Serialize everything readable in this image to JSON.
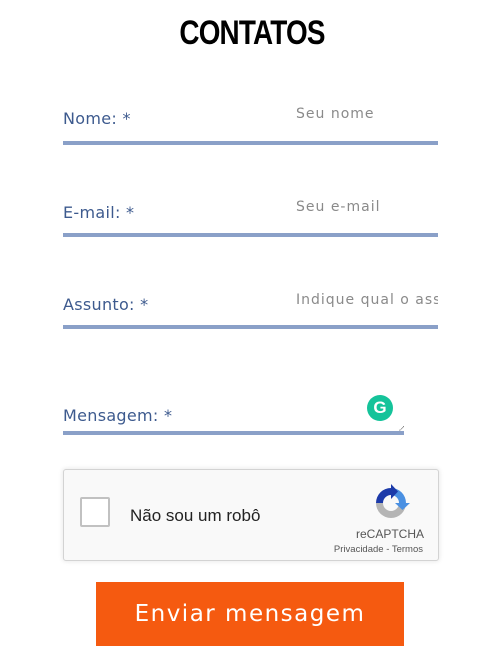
{
  "page": {
    "title": "CONTATOS"
  },
  "form": {
    "name": {
      "label": "Nome: *",
      "placeholder": "Seu nome"
    },
    "email": {
      "label": "E-mail: *",
      "placeholder": "Seu e-mail"
    },
    "subject": {
      "label": "Assunto: *",
      "placeholder": "Indique qual o assunto"
    },
    "message": {
      "label": "Mensagem: *"
    },
    "submit_label": "Enviar mensagem"
  },
  "grammarly": {
    "letter": "G"
  },
  "recaptcha": {
    "checkbox_label": "Não sou um robô",
    "brand": "reCAPTCHA",
    "privacy": "Privacidade",
    "separator": " - ",
    "terms": "Termos"
  },
  "colors": {
    "label": "#3d5a8e",
    "underline": "#8aa0c8",
    "button": "#f55a10",
    "grammarly": "#15c39a"
  }
}
